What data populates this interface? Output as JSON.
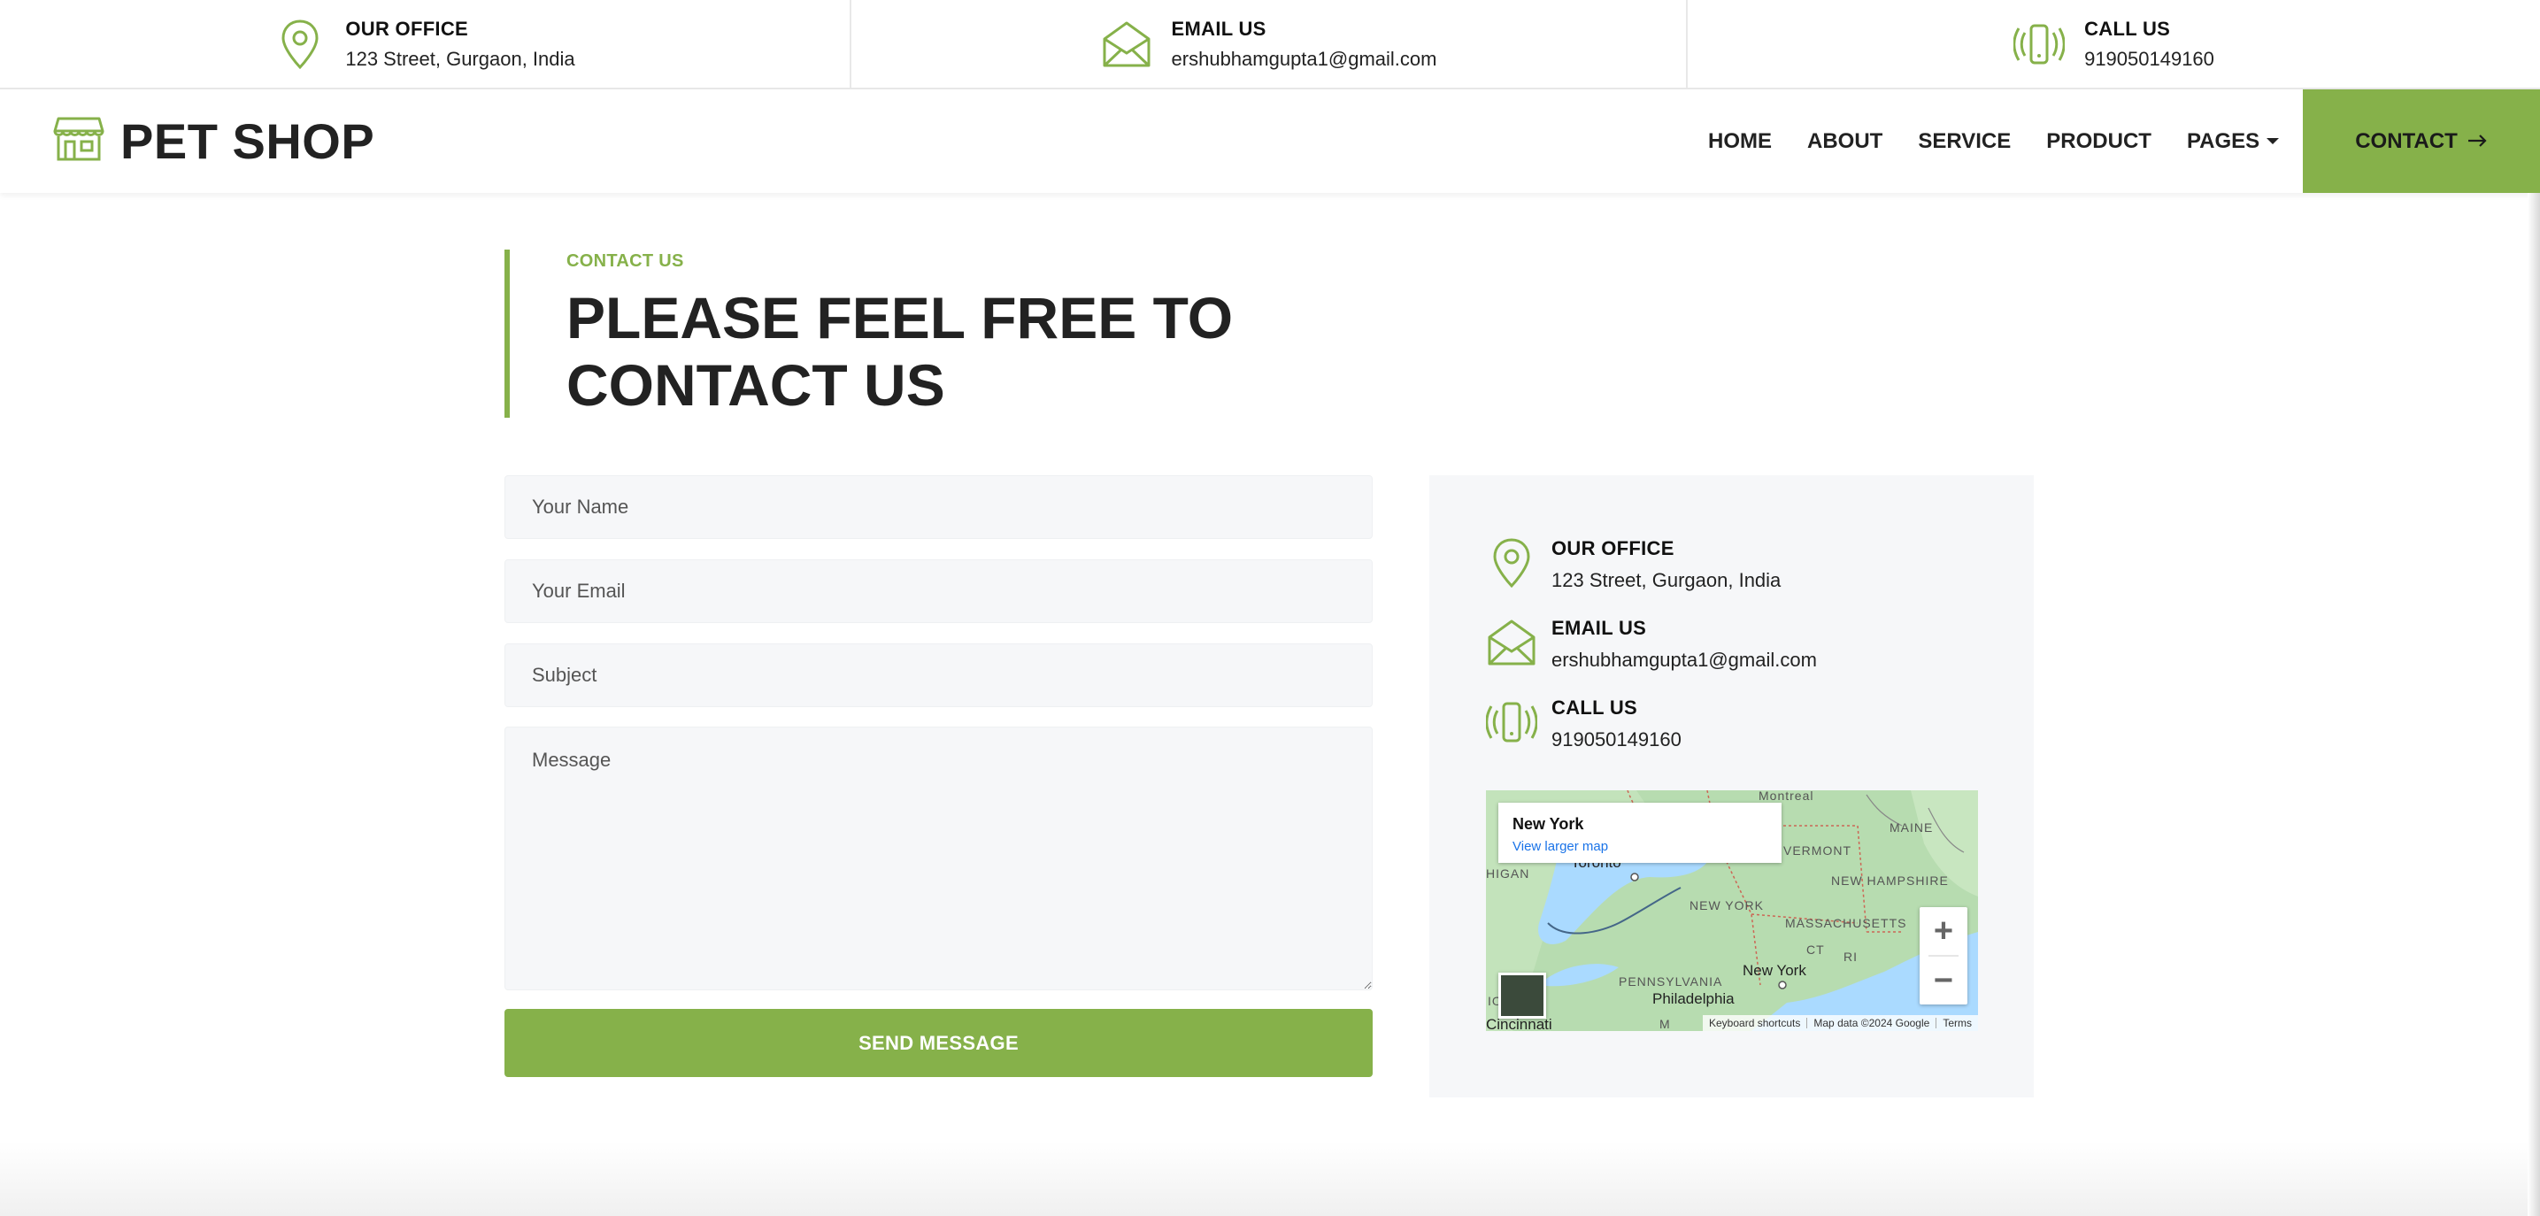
{
  "topbar": {
    "office": {
      "title": "OUR OFFICE",
      "value": "123 Street, Gurgaon, India",
      "icon": "location-pin-icon"
    },
    "email": {
      "title": "EMAIL US",
      "value": "ershubhamgupta1@gmail.com",
      "icon": "envelope-icon"
    },
    "call": {
      "title": "CALL US",
      "value": "919050149160",
      "icon": "phone-vibrate-icon"
    }
  },
  "navbar": {
    "brand": "PET SHOP",
    "brand_icon": "shop-icon",
    "links": [
      "HOME",
      "ABOUT",
      "SERVICE",
      "PRODUCT",
      "PAGES"
    ],
    "contact_label": "CONTACT",
    "contact_icon": "arrow-right-icon"
  },
  "section": {
    "eyebrow": "CONTACT US",
    "headline_line1": "PLEASE FEEL FREE TO",
    "headline_line2": "CONTACT US"
  },
  "form": {
    "name_placeholder": "Your Name",
    "email_placeholder": "Your Email",
    "subject_placeholder": "Subject",
    "message_placeholder": "Message",
    "submit_label": "SEND MESSAGE"
  },
  "card": {
    "office": {
      "title": "OUR OFFICE",
      "value": "123 Street, Gurgaon, India"
    },
    "email": {
      "title": "EMAIL US",
      "value": "ershubhamgupta1@gmail.com"
    },
    "call": {
      "title": "CALL US",
      "value": "919050149160"
    }
  },
  "map": {
    "place": "New York",
    "larger_map": "View larger map",
    "zoom_in": "+",
    "zoom_out": "−",
    "footer_shortcuts": "Keyboard shortcuts",
    "footer_data": "Map data ©2024 Google",
    "footer_terms": "Terms",
    "labels": [
      "Montreal",
      "MAINE",
      "VERMONT",
      "NEW HAMPSHIRE",
      "Toronto",
      "HIGAN",
      "NEW YORK",
      "MASSACHUSETTS",
      "CT",
      "RI",
      "PENNSYLVANIA",
      "New York",
      "Philadelphia",
      "M",
      "Cincinnati",
      "IO"
    ]
  },
  "colors": {
    "accent": "#86b14a",
    "text": "#222222",
    "panel": "#f6f7f9"
  }
}
